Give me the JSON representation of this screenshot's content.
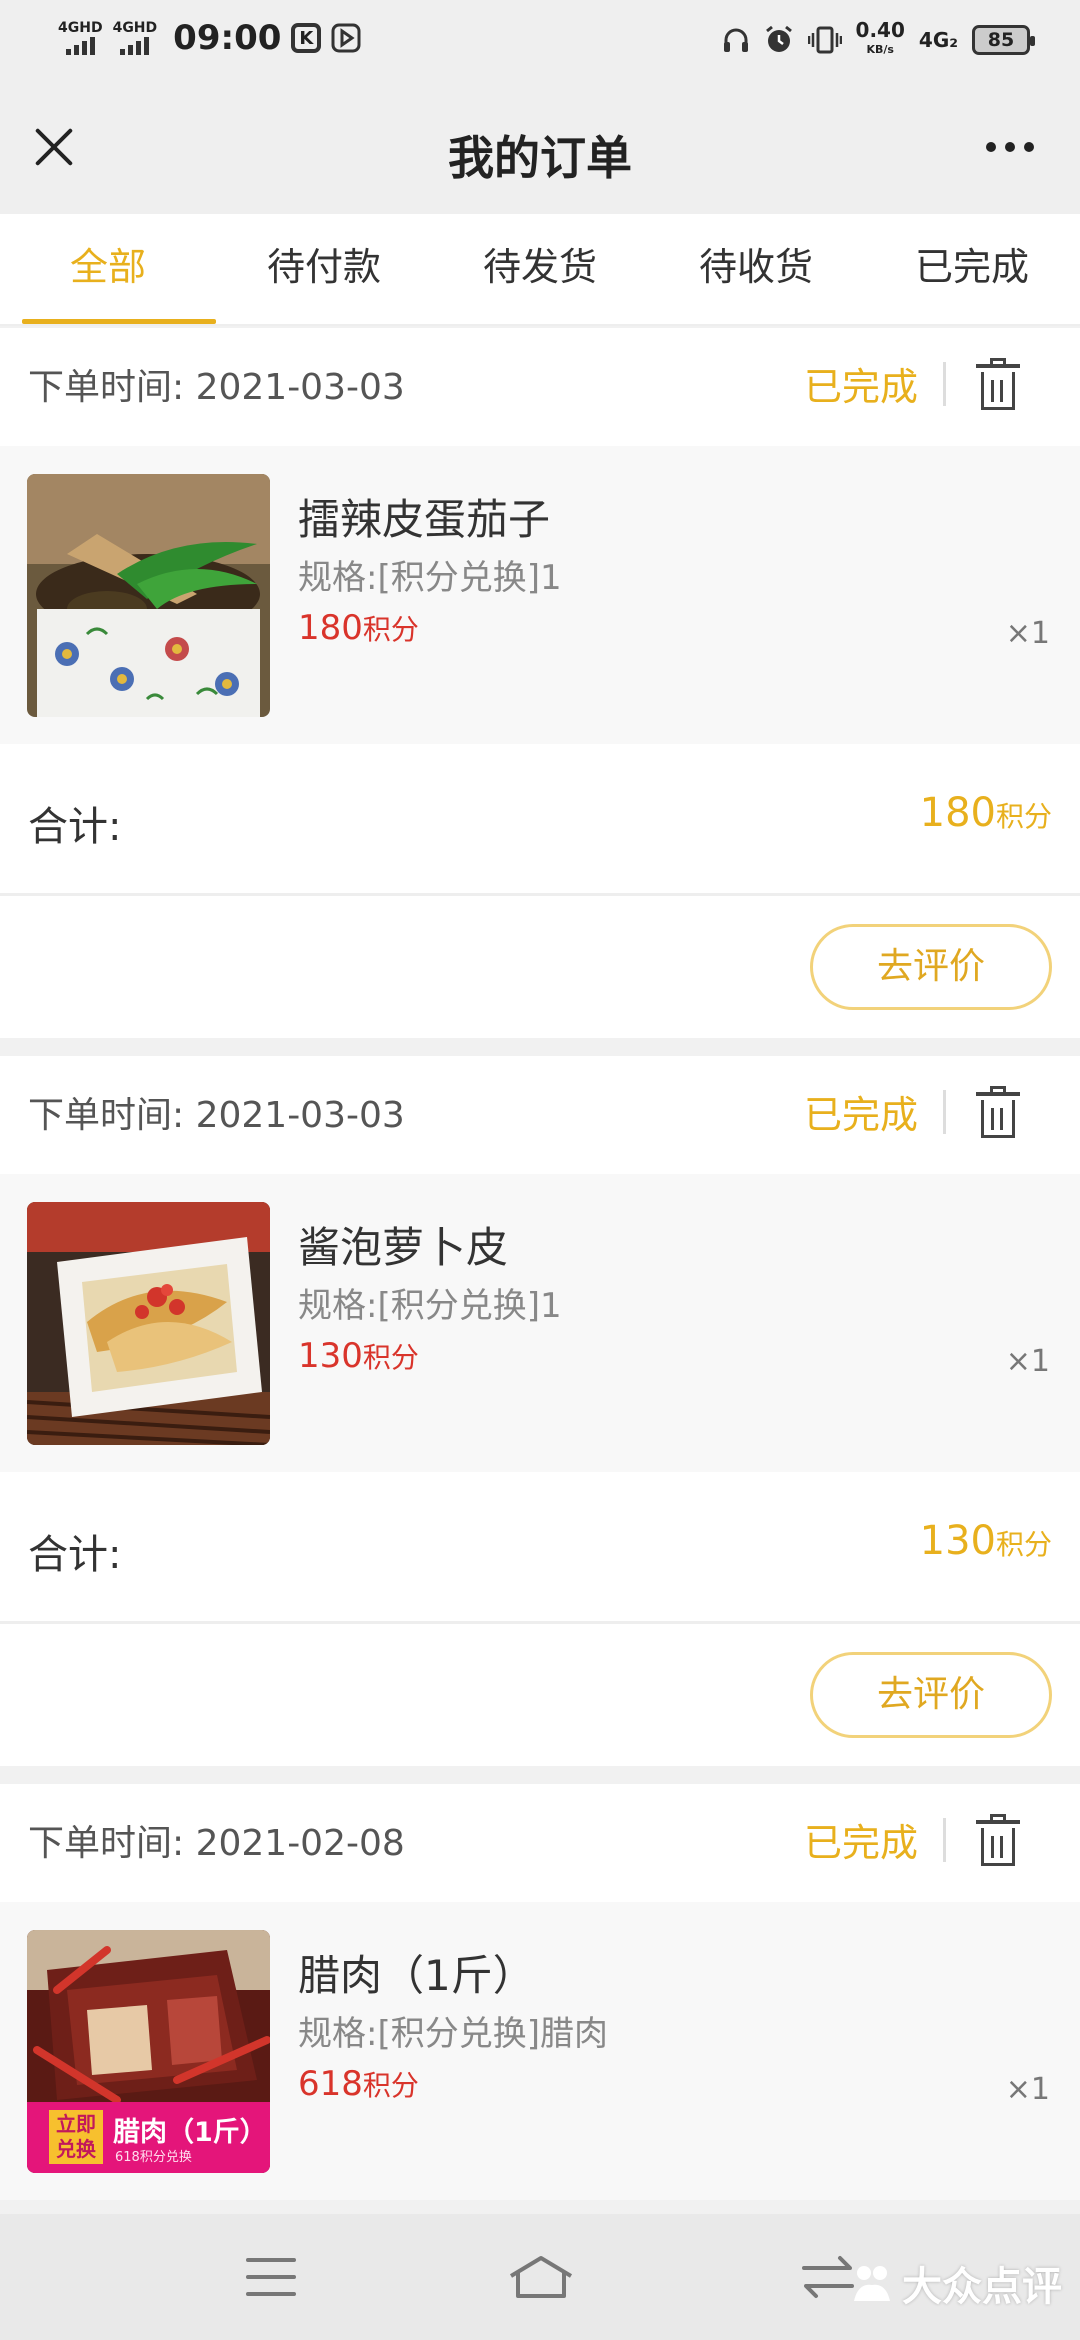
{
  "status_bar": {
    "network_1": "4GHD",
    "network_2": "4GHD",
    "time": "09:00",
    "app_icon_k": "K",
    "speed": "0.40",
    "speed_unit": "KB/s",
    "network_3": "4G₂",
    "battery": "85"
  },
  "header": {
    "title": "我的订单",
    "close_icon": "close-icon",
    "more_icon": "more-icon"
  },
  "tabs": [
    "全部",
    "待付款",
    "待发货",
    "待收货",
    "已完成"
  ],
  "active_tab_index": 0,
  "labels": {
    "date_prefix": "下单时间: ",
    "total": "合计:",
    "review_button": "去评价",
    "points_unit": "积分"
  },
  "orders": [
    {
      "date": "2021-03-03",
      "status": "已完成",
      "item_name": "擂辣皮蛋茄子",
      "spec": "规格:[积分兑换]1",
      "price": "180",
      "qty": "×1",
      "total": "180"
    },
    {
      "date": "2021-03-03",
      "status": "已完成",
      "item_name": "酱泡萝卜皮",
      "spec": "规格:[积分兑换]1",
      "price": "130",
      "qty": "×1",
      "total": "130"
    },
    {
      "date": "2021-02-08",
      "status": "已完成",
      "item_name": "腊肉（1斤）",
      "spec": "规格:[积分兑换]腊肉",
      "price": "618",
      "qty": "×1",
      "badge_left": "立即兑换",
      "badge_title": "腊肉（1斤）",
      "badge_sub": "618积分兑换"
    }
  ],
  "watermark": "大众点评",
  "colors": {
    "accent": "#e8b01d",
    "price": "#d9342b",
    "badge": "#e4157a"
  }
}
